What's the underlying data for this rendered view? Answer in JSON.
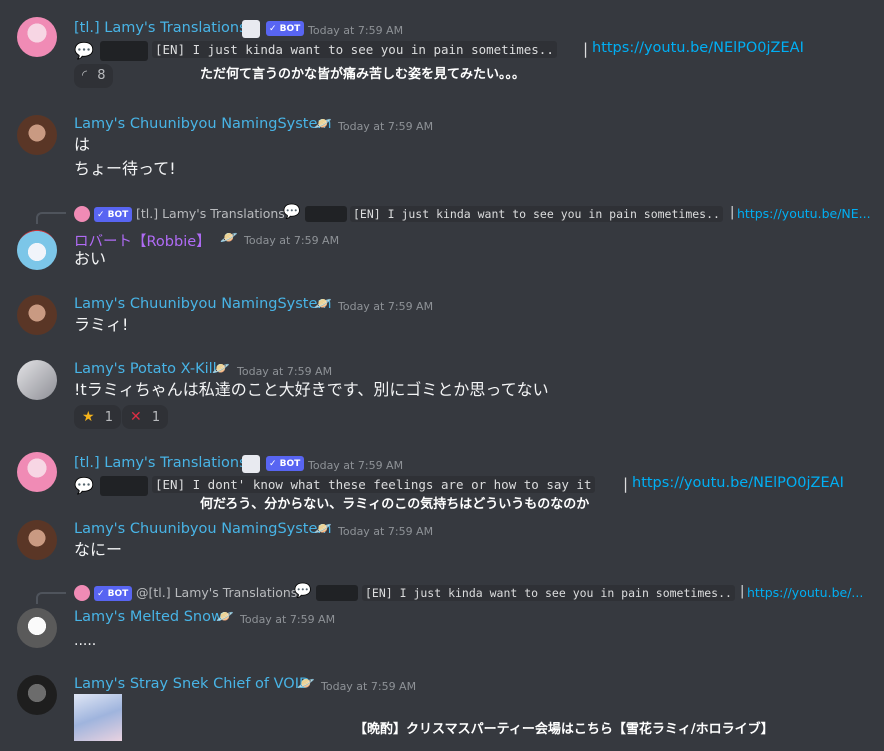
{
  "messages": [
    {
      "author": "[tl.] Lamy's Translations",
      "bot": "✓ BOT",
      "time": "Today at 7:59 AM",
      "code": "[EN] I just kinda want to see you in pain sometimes..",
      "sep": "|",
      "link": "https://youtu.be/NElPO0jZEAI",
      "jp": "ただ何て言うのかな皆が痛み苦しむ姿を見てみたい。。。",
      "reaction_count": "8"
    },
    {
      "author": "Lamy's Chuunibyou NamingSystem",
      "time": "Today at 7:59 AM",
      "line1": "は",
      "line2": "ちょー待って!"
    },
    {
      "reply_author": "[tl.] Lamy's Translations",
      "reply_bot": "✓ BOT",
      "reply_code": "[EN] I just kinda want to see you in pain sometimes..",
      "reply_link": "https://youtu.be/NE...",
      "author": "ロバート【Robbie】",
      "time": "Today at 7:59 AM",
      "text": "おい"
    },
    {
      "author": "Lamy's Chuunibyou NamingSystem",
      "time": "Today at 7:59 AM",
      "text": "ラミィ!"
    },
    {
      "author": "Lamy's Potato X-Kill",
      "time": "Today at 7:59 AM",
      "text": "!tラミィちゃんは私達のこと大好きです、別にゴミとか思ってない",
      "reactions": [
        {
          "emoji": "★",
          "count": "1"
        },
        {
          "emoji": "✕",
          "count": "1"
        }
      ]
    },
    {
      "author": "[tl.] Lamy's Translations",
      "bot": "✓ BOT",
      "time": "Today at 7:59 AM",
      "code": "[EN] I dont' know what these feelings are or how to say it",
      "sep": "|",
      "link": "https://youtu.be/NElPO0jZEAI",
      "jp": "何だろう、分からない、ラミィのこの気持ちはどういうものなのか"
    },
    {
      "author": "Lamy's Chuunibyou NamingSystem",
      "time": "Today at 7:59 AM",
      "text": "なにー"
    },
    {
      "reply_author": "@[tl.] Lamy's Translations",
      "reply_bot": "✓ BOT",
      "reply_code": "[EN] I just kinda want to see you in pain sometimes..",
      "reply_link": "https://youtu.be/...",
      "author": "Lamy's Melted Snow",
      "time": "Today at 7:59 AM",
      "text": "....."
    },
    {
      "author": "Lamy's Stray Snek Chief of VOID",
      "time": "Today at 7:59 AM",
      "caption": "【晩酌】クリスマスパーティー会場はこちら【雪花ラミィ/ホロライブ】"
    }
  ],
  "colors": {
    "background": "#36393f",
    "name_cyan": "#48b4e6",
    "name_purple": "#b06bf5",
    "link": "#00aff4",
    "bot_badge": "#5865f2"
  }
}
